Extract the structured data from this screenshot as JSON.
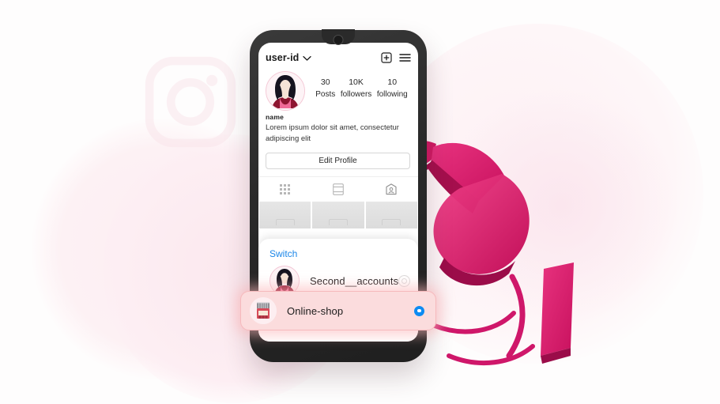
{
  "app": {
    "profile_username": "user-id",
    "profile_name": "name",
    "bio": "Lorem ipsum dolor sit amet, consectetur adipiscing elit",
    "edit_profile_label": "Edit Profile"
  },
  "header": {
    "username": "user-id",
    "dropdown_icon": "chevron-down-icon",
    "add_post_icon": "add-post-icon",
    "menu_icon": "hamburger-menu-icon"
  },
  "stats": [
    {
      "value": "30",
      "label": "Posts"
    },
    {
      "value": "10K",
      "label": "followers"
    },
    {
      "value": "10",
      "label": "following"
    }
  ],
  "tabs": [
    {
      "icon": "grid-icon",
      "name": "posts-tab"
    },
    {
      "icon": "reels-icon",
      "name": "reels-tab"
    },
    {
      "icon": "tagged-icon",
      "name": "tagged-tab"
    }
  ],
  "switch_sheet": {
    "title": "Switch",
    "accounts": [
      {
        "name": "Second__accounts",
        "selected": false,
        "avatar": "woman-avatar"
      },
      {
        "name": "Online-shop",
        "selected": true,
        "avatar": "shop-icon"
      }
    ]
  },
  "colors": {
    "accent_blue": "#0d8bf2",
    "switch_title_blue": "#1b86e8",
    "highlight_pink_bg": "#fbdcdd",
    "highlight_pink_border": "#f6b9bc",
    "hand_magenta": "#e01a6f",
    "hand_dark_magenta": "#b3155b",
    "phone_body": "#2b2b2b",
    "page_background": "#fefdfd"
  },
  "decorations": {
    "watermark_icon": "instagram-camera-logo",
    "illustration": "pointing-hand-illustration"
  }
}
